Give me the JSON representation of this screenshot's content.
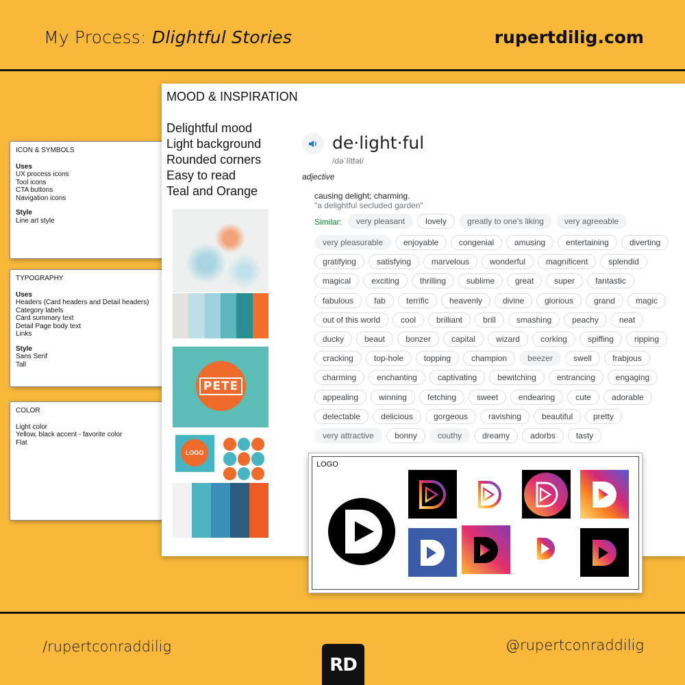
{
  "header": {
    "title_prefix": "My Process: ",
    "title_italic": "Dlightful Stories",
    "site": "rupertdilig.com"
  },
  "footer": {
    "left_handle": "/rupertconraddilig",
    "right_handle": "@rupertconraddilig",
    "logo_text": "RD"
  },
  "cards": {
    "icons": {
      "title": "ICON & SYMBOLS",
      "uses_label": "Uses",
      "uses": [
        "UX process icons",
        "Tool icons",
        "CTA buttons",
        "Navigation icons"
      ],
      "style_label": "Style",
      "style": [
        "Line art style"
      ]
    },
    "typography": {
      "title": "TYPOGRAPHY",
      "uses_label": "Uses",
      "uses": [
        "Headers (Card headers and Detail headers)",
        "Category labels",
        "Card summary text",
        "Detail Page body text",
        "Links"
      ],
      "style_label": "Style",
      "style": [
        "Sans Serif",
        "Tall"
      ]
    },
    "color": {
      "title": "COLOR",
      "items": [
        "Light color",
        "Yellow, black accent - favorite color",
        "Flat"
      ]
    }
  },
  "mood": {
    "title": "MOOD & INSPIRATION",
    "list": [
      "Delightful mood",
      "Light background",
      "Rounded corners",
      "Easy to read",
      "Teal and Orange"
    ],
    "pete_text": "PETE",
    "logo_small_text": "LOGO",
    "swatches_top": [
      "#e4e2dd",
      "#bde0e8",
      "#9fd1dc",
      "#5bb6be",
      "#2b8e93",
      "#f36d2b"
    ],
    "swatches_bottom": [
      "#f2f2f2",
      "#4db5c1",
      "#3a8fb8",
      "#2c5d7e",
      "#ef5b24"
    ]
  },
  "dictionary": {
    "word": "de·light·ful",
    "phonetic": "/dəˈlītfəl/",
    "part_of_speech": "adjective",
    "definition": "causing delight; charming.",
    "example": "\"a delightful secluded garden\"",
    "similar_label": "Similar:",
    "chips": [
      [
        {
          "t": "very pleasant",
          "g": true
        },
        {
          "t": "lovely",
          "g": false
        },
        {
          "t": "greatly to one's liking",
          "g": true
        },
        {
          "t": "very agreeable",
          "g": true
        }
      ],
      [
        {
          "t": "very pleasurable",
          "g": true
        },
        {
          "t": "enjoyable",
          "g": false
        },
        {
          "t": "congenial",
          "g": false
        },
        {
          "t": "amusing",
          "g": false
        },
        {
          "t": "entertaining",
          "g": false
        },
        {
          "t": "diverting",
          "g": false
        }
      ],
      [
        {
          "t": "gratifying",
          "g": false
        },
        {
          "t": "satisfying",
          "g": false
        },
        {
          "t": "marvelous",
          "g": false
        },
        {
          "t": "wonderful",
          "g": false
        },
        {
          "t": "magnificent",
          "g": false
        },
        {
          "t": "splendid",
          "g": false
        }
      ],
      [
        {
          "t": "magical",
          "g": false
        },
        {
          "t": "exciting",
          "g": false
        },
        {
          "t": "thrilling",
          "g": false
        },
        {
          "t": "sublime",
          "g": false
        },
        {
          "t": "great",
          "g": false
        },
        {
          "t": "super",
          "g": false
        },
        {
          "t": "fantastic",
          "g": false
        }
      ],
      [
        {
          "t": "fabulous",
          "g": false
        },
        {
          "t": "fab",
          "g": false
        },
        {
          "t": "terrific",
          "g": false
        },
        {
          "t": "heavenly",
          "g": false
        },
        {
          "t": "divine",
          "g": false
        },
        {
          "t": "glorious",
          "g": false
        },
        {
          "t": "grand",
          "g": false
        },
        {
          "t": "magic",
          "g": false
        }
      ],
      [
        {
          "t": "out of this world",
          "g": false
        },
        {
          "t": "cool",
          "g": false
        },
        {
          "t": "brilliant",
          "g": false
        },
        {
          "t": "brill",
          "g": false
        },
        {
          "t": "smashing",
          "g": false
        },
        {
          "t": "peachy",
          "g": false
        },
        {
          "t": "neat",
          "g": false
        }
      ],
      [
        {
          "t": "ducky",
          "g": false
        },
        {
          "t": "beaut",
          "g": false
        },
        {
          "t": "bonzer",
          "g": false
        },
        {
          "t": "capital",
          "g": false
        },
        {
          "t": "wizard",
          "g": false
        },
        {
          "t": "corking",
          "g": false
        },
        {
          "t": "spiffing",
          "g": false
        },
        {
          "t": "ripping",
          "g": false
        }
      ],
      [
        {
          "t": "cracking",
          "g": false
        },
        {
          "t": "top-hole",
          "g": false
        },
        {
          "t": "topping",
          "g": false
        },
        {
          "t": "champion",
          "g": false
        },
        {
          "t": "beezer",
          "g": true
        },
        {
          "t": "swell",
          "g": false
        },
        {
          "t": "frabjous",
          "g": false
        }
      ],
      [
        {
          "t": "charming",
          "g": false
        },
        {
          "t": "enchanting",
          "g": false
        },
        {
          "t": "captivating",
          "g": false
        },
        {
          "t": "bewitching",
          "g": false
        },
        {
          "t": "entrancing",
          "g": false
        },
        {
          "t": "engaging",
          "g": false
        }
      ],
      [
        {
          "t": "appealing",
          "g": false
        },
        {
          "t": "winning",
          "g": false
        },
        {
          "t": "fetching",
          "g": false
        },
        {
          "t": "sweet",
          "g": false
        },
        {
          "t": "endearing",
          "g": false
        },
        {
          "t": "cute",
          "g": false
        },
        {
          "t": "adorable",
          "g": false
        }
      ],
      [
        {
          "t": "delectable",
          "g": false
        },
        {
          "t": "delicious",
          "g": false
        },
        {
          "t": "gorgeous",
          "g": false
        },
        {
          "t": "ravishing",
          "g": false
        },
        {
          "t": "beautiful",
          "g": false
        },
        {
          "t": "pretty",
          "g": false
        }
      ],
      [
        {
          "t": "very attractive",
          "g": true
        },
        {
          "t": "bonny",
          "g": false
        },
        {
          "t": "couthy",
          "g": true
        },
        {
          "t": "dreamy",
          "g": false
        },
        {
          "t": "adorbs",
          "g": false
        },
        {
          "t": "tasty",
          "g": false
        }
      ]
    ]
  },
  "logo_panel": {
    "title": "LOGO"
  },
  "colors": {
    "background": "#F8B83A",
    "teal": "#5cbdb5",
    "orange": "#ef6b2b",
    "similar_green": "#188038"
  }
}
